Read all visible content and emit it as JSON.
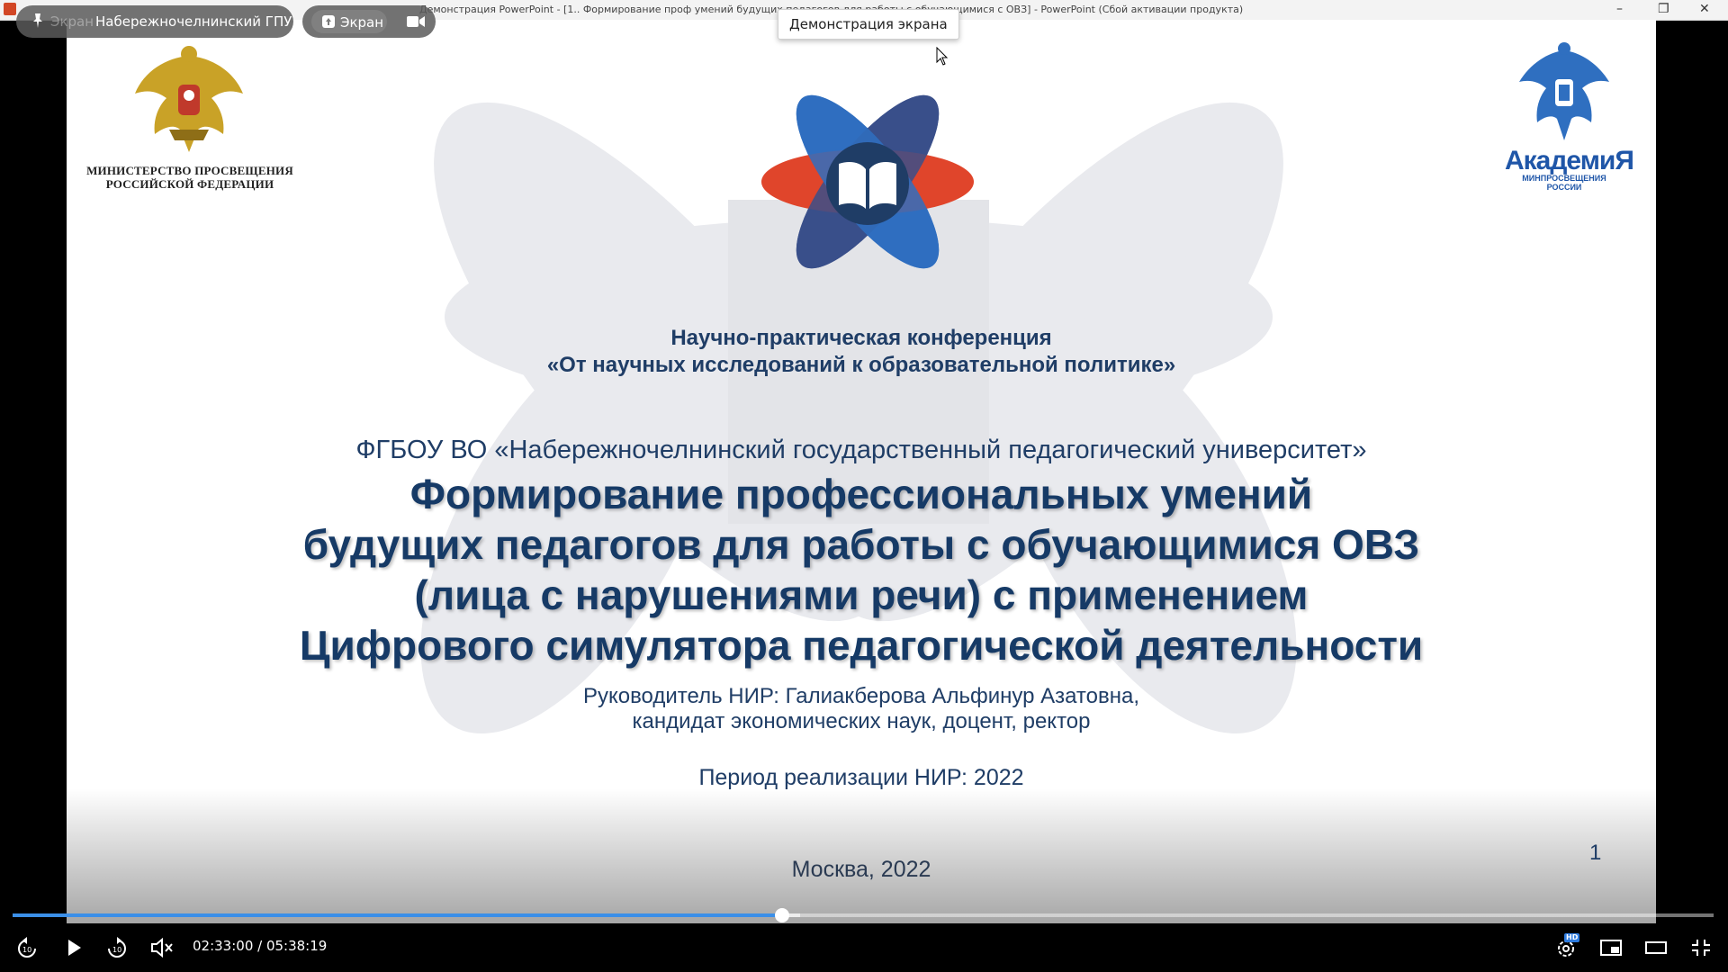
{
  "window": {
    "title": "Демонстрация PowerPoint - [1.. Формирование проф умений будущих педагогов для работы с обучающимися с ОВЗ] - PowerPoint (Сбой активации продукта)",
    "minimize_glyph": "–",
    "restore_glyph": "❐",
    "close_glyph": "✕"
  },
  "overlay": {
    "faded_label": "Экран",
    "organizer": "Набережночелнинский ГПУ",
    "screen_label": "Экран",
    "tooltip": "Демонстрация экрана"
  },
  "slide": {
    "ministry_line1": "МИНИСТЕРСТВО ПРОСВЕЩЕНИЯ",
    "ministry_line2": "РОССИЙСКОЙ ФЕДЕРАЦИИ",
    "academy_name": "АкадемиЯ",
    "academy_sub": "МИНПРОСВЕЩЕНИЯ РОССИИ",
    "conference_line1": "Научно-практическая конференция",
    "conference_line2": "«От научных исследований к образовательной политике»",
    "university": "ФГБОУ ВО «Набережночелнинский государственный педагогический университет»",
    "title_lines": [
      "Формирование профессиональных умений",
      "будущих педагогов для работы с обучающимися ОВЗ",
      "(лица с нарушениями речи) с применением",
      "Цифрового симулятора педагогической деятельности"
    ],
    "supervisor_line1": "Руководитель НИР:  Галиакберова Альфинур Азатовна,",
    "supervisor_line2": "кандидат экономических наук, доцент, ректор",
    "period": "Период реализации НИР: 2022",
    "city": "Москва, 2022",
    "slide_number": "1"
  },
  "player": {
    "time": "02:33:00 / 05:38:19",
    "hd_label": "HD",
    "progress_played": 0.4526,
    "progress_buffered": 0.463
  },
  "colors": {
    "accent_blue": "#2f6fc0",
    "accent_red": "#e0452b",
    "text_navy": "#1f3d66",
    "progress": "#3b8fe8"
  }
}
